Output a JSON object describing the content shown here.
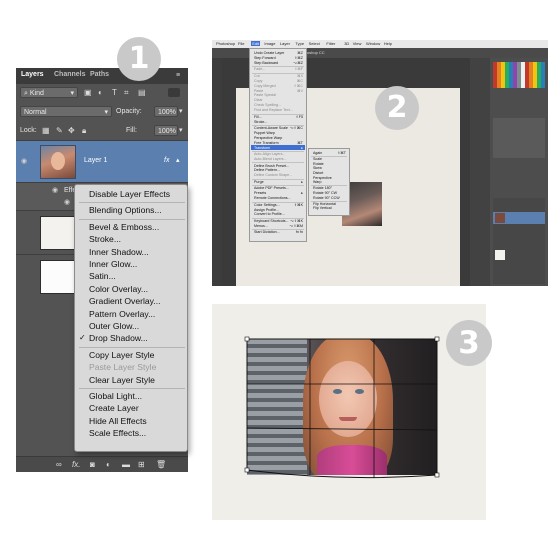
{
  "badges": {
    "one": "1",
    "two": "2",
    "three": "3"
  },
  "layers_panel": {
    "tabs": [
      "Layers",
      "Channels",
      "Paths"
    ],
    "filter_kind": "Kind",
    "blend_mode": "Normal",
    "opacity_label": "Opacity:",
    "opacity_value": "100%",
    "lock_label": "Lock:",
    "fill_label": "Fill:",
    "fill_value": "100%",
    "layer1_name": "Layer 1",
    "fx_badge": "fx",
    "effects_label": "Effe",
    "footer_fx": "fx."
  },
  "context_menu": {
    "items": [
      {
        "label": "Disable Layer Effects",
        "enabled": true
      },
      {
        "label": "Blending Options...",
        "enabled": true
      },
      {
        "label": "Bevel & Emboss...",
        "enabled": true
      },
      {
        "label": "Stroke...",
        "enabled": true
      },
      {
        "label": "Inner Shadow...",
        "enabled": true
      },
      {
        "label": "Inner Glow...",
        "enabled": true
      },
      {
        "label": "Satin...",
        "enabled": true
      },
      {
        "label": "Color Overlay...",
        "enabled": true
      },
      {
        "label": "Gradient Overlay...",
        "enabled": true
      },
      {
        "label": "Pattern Overlay...",
        "enabled": true
      },
      {
        "label": "Outer Glow...",
        "enabled": true
      },
      {
        "label": "Drop Shadow...",
        "enabled": true,
        "checked": true
      },
      {
        "label": "Copy Layer Style",
        "enabled": true
      },
      {
        "label": "Paste Layer Style",
        "enabled": false
      },
      {
        "label": "Clear Layer Style",
        "enabled": true
      },
      {
        "label": "Global Light...",
        "enabled": true
      },
      {
        "label": "Create Layer",
        "enabled": true
      },
      {
        "label": "Hide All Effects",
        "enabled": true
      },
      {
        "label": "Scale Effects...",
        "enabled": true
      }
    ],
    "check_mark": "✓"
  },
  "photoshop_window": {
    "menubar": [
      "Photoshop",
      "File",
      "Edit",
      "Image",
      "Layer",
      "Type",
      "Select",
      "Filter",
      "3D",
      "View",
      "Window",
      "Help"
    ],
    "title": "Adobe Photoshop CC",
    "edit_menu": [
      {
        "label": "Undo Create Layer",
        "shortcut": "⌘Z"
      },
      {
        "label": "Step Forward",
        "shortcut": "⇧⌘Z"
      },
      {
        "label": "Step Backward",
        "shortcut": "⌥⌘Z"
      },
      {
        "label": "Fade...",
        "shortcut": "⇧⌘F",
        "disabled": true
      },
      {
        "label": "Cut",
        "shortcut": "⌘X",
        "disabled": true
      },
      {
        "label": "Copy",
        "shortcut": "⌘C",
        "disabled": true
      },
      {
        "label": "Copy Merged",
        "shortcut": "⇧⌘C",
        "disabled": true
      },
      {
        "label": "Paste",
        "shortcut": "⌘V",
        "disabled": true
      },
      {
        "label": "Paste Special",
        "shortcut": "",
        "disabled": true
      },
      {
        "label": "Clear",
        "shortcut": "",
        "disabled": true
      },
      {
        "label": "Check Spelling...",
        "shortcut": "",
        "disabled": true
      },
      {
        "label": "Find and Replace Text...",
        "shortcut": "",
        "disabled": true
      },
      {
        "label": "Fill...",
        "shortcut": "⇧F5"
      },
      {
        "label": "Stroke...",
        "shortcut": ""
      },
      {
        "label": "Content-Aware Scale",
        "shortcut": "⌥⇧⌘C"
      },
      {
        "label": "Puppet Warp",
        "shortcut": ""
      },
      {
        "label": "Perspective Warp",
        "shortcut": ""
      },
      {
        "label": "Free Transform",
        "shortcut": "⌘T"
      },
      {
        "label": "Transform",
        "shortcut": "▸",
        "highlight": true
      },
      {
        "label": "Auto-Align Layers...",
        "shortcut": "",
        "disabled": true
      },
      {
        "label": "Auto-Blend Layers...",
        "shortcut": "",
        "disabled": true
      },
      {
        "label": "Define Brush Preset...",
        "shortcut": ""
      },
      {
        "label": "Define Pattern...",
        "shortcut": ""
      },
      {
        "label": "Define Custom Shape...",
        "shortcut": "",
        "disabled": true
      },
      {
        "label": "Purge",
        "shortcut": "▸"
      },
      {
        "label": "Adobe PDF Presets...",
        "shortcut": ""
      },
      {
        "label": "Presets",
        "shortcut": "▸"
      },
      {
        "label": "Remote Connections...",
        "shortcut": ""
      },
      {
        "label": "Color Settings...",
        "shortcut": "⇧⌘K"
      },
      {
        "label": "Assign Profile...",
        "shortcut": ""
      },
      {
        "label": "Convert to Profile...",
        "shortcut": ""
      },
      {
        "label": "Keyboard Shortcuts...",
        "shortcut": "⌥⇧⌘K"
      },
      {
        "label": "Menus...",
        "shortcut": "⌥⇧⌘M"
      },
      {
        "label": "Start Dictation...",
        "shortcut": "fn fn"
      }
    ],
    "transform_menu": [
      {
        "label": "Again",
        "shortcut": "⇧⌘T"
      },
      {
        "label": "Scale"
      },
      {
        "label": "Rotate"
      },
      {
        "label": "Skew"
      },
      {
        "label": "Distort"
      },
      {
        "label": "Perspective"
      },
      {
        "label": "Warp"
      },
      {
        "label": "Rotate 180°"
      },
      {
        "label": "Rotate 90° CW"
      },
      {
        "label": "Rotate 90° CCW"
      },
      {
        "label": "Flip Horizontal"
      },
      {
        "label": "Flip Vertical"
      }
    ]
  },
  "colors": {
    "panel_bg": "#535353",
    "selected_layer": "#5b7fae",
    "menu_bg": "#d9d9d9",
    "menu_highlight": "#3f6fd0",
    "canvas_bg": "#f0eee9"
  }
}
